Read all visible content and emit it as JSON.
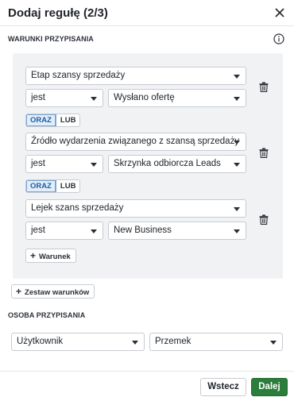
{
  "dialog": {
    "title": "Dodaj regułę (2/3)",
    "close_icon": "close-icon",
    "info_icon": "info-icon"
  },
  "conditions": {
    "label": "WARUNKI PRZYPISANIA",
    "groups": [
      {
        "field": "Etap szansy sprzedaży",
        "operator": "jest",
        "value": "Wysłano ofertę"
      },
      {
        "field": "Źródło wydarzenia związanego z szansą sprzedaży",
        "operator": "jest",
        "value": "Skrzynka odbiorcza Leads"
      },
      {
        "field": "Lejek szans sprzedaży",
        "operator": "jest",
        "value": "New Business"
      }
    ],
    "toggle_and": "ORAZ",
    "toggle_or": "LUB",
    "add_condition_label": "Warunek",
    "add_set_label": "Zestaw warunków"
  },
  "assignee": {
    "label": "OSOBA PRZYPISANIA",
    "type_value": "Użytkownik",
    "user_value": "Przemek"
  },
  "footer": {
    "back_label": "Wstecz",
    "next_label": "Dalej"
  },
  "colors": {
    "primary": "#2a7d3a",
    "accent_toggle": "#1b5fa8",
    "panel_bg": "#f1f2f4"
  }
}
